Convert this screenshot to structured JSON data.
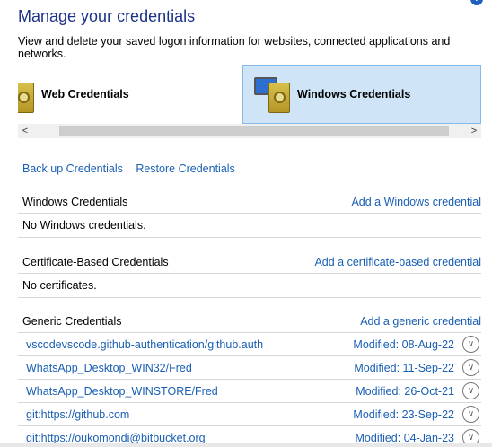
{
  "header": {
    "title": "Manage your credentials",
    "subtitle": "View and delete your saved logon information for websites, connected applications and networks.",
    "help_glyph": "?"
  },
  "tiles": {
    "web_label": "Web Credentials",
    "windows_label": "Windows Credentials"
  },
  "scroll": {
    "left": "<",
    "right": ">"
  },
  "links": {
    "backup": "Back up Credentials",
    "restore": "Restore Credentials"
  },
  "windows_section": {
    "title": "Windows Credentials",
    "add": "Add a Windows credential",
    "empty": "No Windows credentials."
  },
  "cert_section": {
    "title": "Certificate-Based Credentials",
    "add": "Add a certificate-based credential",
    "empty": "No certificates."
  },
  "generic_section": {
    "title": "Generic Credentials",
    "add": "Add a generic credential",
    "items": [
      {
        "name": "vscodevscode.github-authentication/github.auth",
        "modified": "Modified:  08-Aug-22"
      },
      {
        "name": "WhatsApp_Desktop_WIN32/Fred",
        "modified": "Modified:  11-Sep-22"
      },
      {
        "name": "WhatsApp_Desktop_WINSTORE/Fred",
        "modified": "Modified:  26-Oct-21"
      },
      {
        "name": "git:https://github.com",
        "modified": "Modified:  23-Sep-22"
      },
      {
        "name": "git:https://oukomondi@bitbucket.org",
        "modified": "Modified:  04-Jan-23"
      }
    ]
  },
  "icons": {
    "expand": "chevron-down-icon",
    "vault": "vault-icon"
  },
  "colors": {
    "title": "#1e3287",
    "link": "#1a5fb4",
    "selected_tile": "#cfe4f7"
  }
}
